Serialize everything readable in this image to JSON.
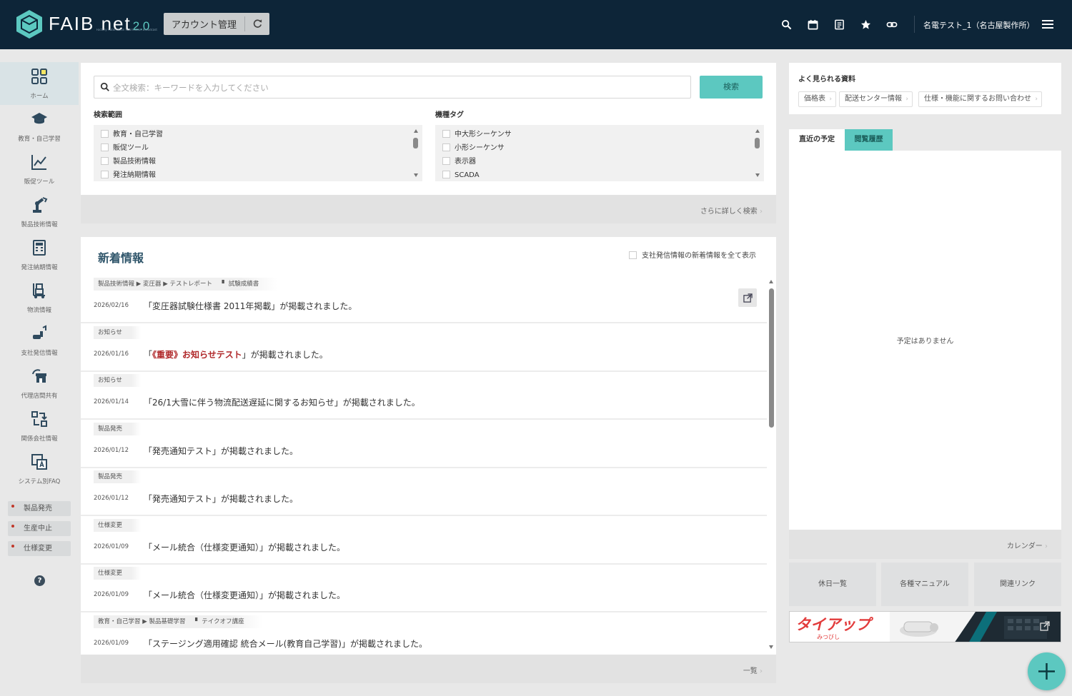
{
  "header": {
    "logo_text": "FAIB",
    "logo_net": "net",
    "logo_version": "2.0",
    "logo_tagline": "Factory Automation Information Broadcast",
    "account_button": "アカウント管理",
    "user_name": "名電テスト_1（名古屋製作所）"
  },
  "sidebar": {
    "nav": [
      {
        "label": "ホーム",
        "icon": "home-grid-icon"
      },
      {
        "label": "教育・自己学習",
        "icon": "graduation-cap-icon"
      },
      {
        "label": "販促ツール",
        "icon": "line-chart-icon"
      },
      {
        "label": "製品技術情報",
        "icon": "robot-arm-icon"
      },
      {
        "label": "発注納期情報",
        "icon": "calculator-icon"
      },
      {
        "label": "物流情報",
        "icon": "hand-truck-icon"
      },
      {
        "label": "支社発信情報",
        "icon": "signal-icon"
      },
      {
        "label": "代理店間共有",
        "icon": "shop-share-icon"
      },
      {
        "label": "関係会社情報",
        "icon": "exchange-icon"
      },
      {
        "label": "システム別FAQ",
        "icon": "faq-icon"
      }
    ],
    "categories": [
      "製品発売",
      "生産中止",
      "仕様変更"
    ],
    "help": "?"
  },
  "search": {
    "placeholder": "全文検索：キーワードを入力してください",
    "button": "検索",
    "scope_label": "検索範囲",
    "scope_items": [
      "教育・自己学習",
      "販促ツール",
      "製品技術情報",
      "発注納期情報"
    ],
    "tag_label": "機種タグ",
    "tag_items": [
      "中大形シーケンサ",
      "小形シーケンサ",
      "表示器",
      "SCADA"
    ],
    "advanced_link": "さらに詳しく検索"
  },
  "news": {
    "title": "新着情報",
    "show_all_label": "支社発信情報の新着情報を全て表示",
    "more_link": "一覧",
    "items": [
      {
        "tags": [
          "製品技術情報",
          "変圧器",
          "テストレポート"
        ],
        "doc": "試験成績書",
        "date": "2026/02/16",
        "pre": "「変圧器試験仕様書 2011年掲載」",
        "highlight": "",
        "post": "が掲載されました。"
      },
      {
        "tags": [
          "お知らせ"
        ],
        "doc": "",
        "date": "2026/01/16",
        "pre": "「",
        "highlight": "《重要》お知らせテスト",
        "post": "」が掲載されました。"
      },
      {
        "tags": [
          "お知らせ"
        ],
        "doc": "",
        "date": "2026/01/14",
        "pre": "「26/1大雪に伴う物流配送遅延に関するお知らせ」",
        "highlight": "",
        "post": "が掲載されました。"
      },
      {
        "tags": [
          "製品発売"
        ],
        "doc": "",
        "date": "2026/01/12",
        "pre": "「発売通知テスト」",
        "highlight": "",
        "post": "が掲載されました。"
      },
      {
        "tags": [
          "製品発売"
        ],
        "doc": "",
        "date": "2026/01/12",
        "pre": "「発売通知テスト」",
        "highlight": "",
        "post": "が掲載されました。"
      },
      {
        "tags": [
          "仕様変更"
        ],
        "doc": "",
        "date": "2026/01/09",
        "pre": "「メール統合（仕様変更通知）」",
        "highlight": "",
        "post": "が掲載されました。"
      },
      {
        "tags": [
          "仕様変更"
        ],
        "doc": "",
        "date": "2026/01/09",
        "pre": "「メール統合（仕様変更通知）」",
        "highlight": "",
        "post": "が掲載されました。"
      },
      {
        "tags": [
          "教育・自己学習",
          "製品基礎学習"
        ],
        "doc": "テイクオフ講座",
        "date": "2026/01/09",
        "pre": "「ステージング適用確認 統合メール(教育自己学習)」",
        "highlight": "",
        "post": "が掲載されました。"
      }
    ]
  },
  "right": {
    "popular_title": "よく見られる資料",
    "popular_items": [
      "価格表",
      "配送センター情報",
      "仕様・機能に関するお問い合わせ"
    ],
    "tab_schedule": "直近の予定",
    "tab_history": "閲覧履歴",
    "schedule_empty": "予定はありません",
    "calendar_link": "カレンダー",
    "tiles": [
      "休日一覧",
      "各種マニュアル",
      "関連リンク"
    ],
    "banner_text": "タイアップ",
    "banner_sub": "みつびし"
  },
  "colors": {
    "header_bg": "#0d2538",
    "accent": "#5cc8c0",
    "highlight": "#b0282a",
    "category_dot": "#c0392b"
  }
}
